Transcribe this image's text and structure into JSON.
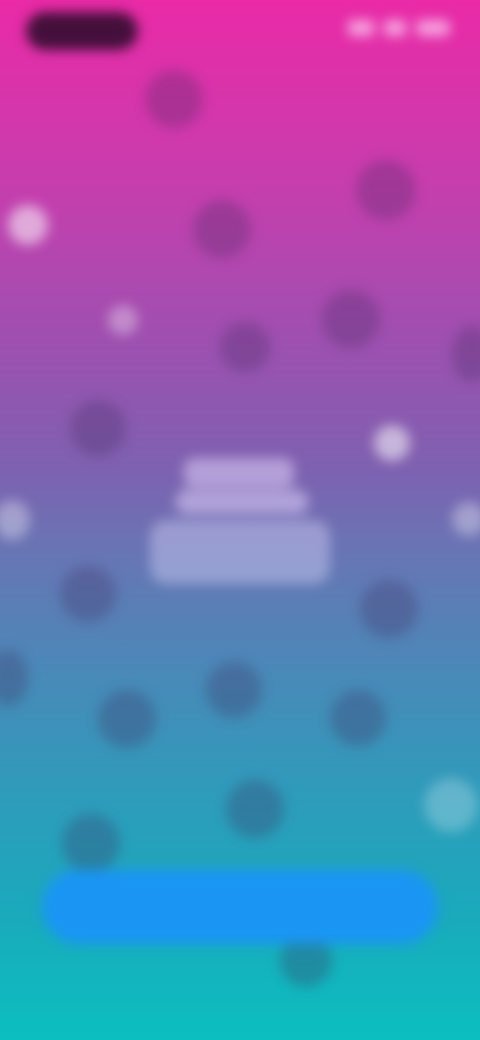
{
  "status_bar": {
    "time": "",
    "icons": [
      "signal-icon",
      "wifi-icon",
      "battery-icon"
    ]
  },
  "center": {
    "title": "",
    "subtitle": "",
    "body": ""
  },
  "primary_button": {
    "label": ""
  },
  "colors": {
    "gradient_top": "#ea2aa7",
    "gradient_middle": "#7e61b0",
    "gradient_bottom": "#0bbfbf",
    "button": "#1a95f4"
  }
}
